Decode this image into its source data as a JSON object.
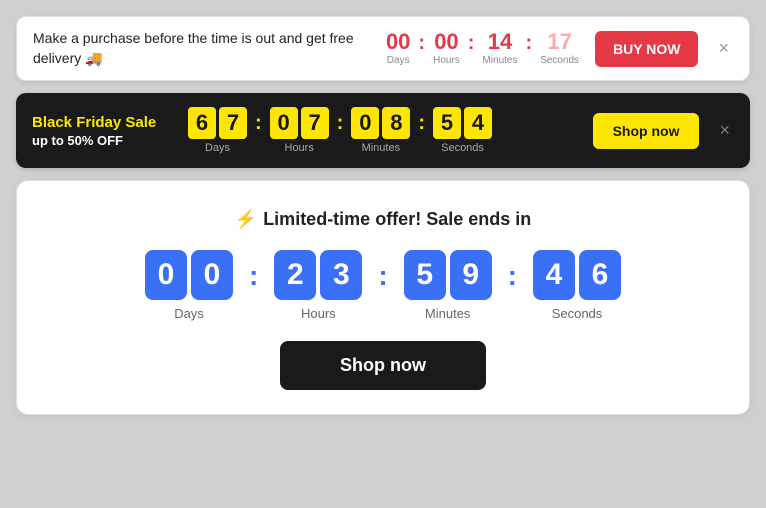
{
  "delivery_banner": {
    "text": "Make a purchase before the time is out and get free delivery 🚚",
    "countdown": {
      "days": {
        "value": "00",
        "label": "Days"
      },
      "hours": {
        "value": "00",
        "label": "Hours"
      },
      "minutes": {
        "value": "14",
        "label": "Minutes"
      },
      "seconds": {
        "value": "17",
        "label": "Seconds"
      }
    },
    "buy_btn": "BUY NOW",
    "close": "×"
  },
  "blackfriday_banner": {
    "title": "Black Friday Sale",
    "subtitle": "up to 50% OFF",
    "countdown": {
      "days": {
        "d1": "6",
        "d2": "7",
        "label": "Days"
      },
      "hours": {
        "d1": "0",
        "d2": "7",
        "label": "Hours"
      },
      "minutes": {
        "d1": "0",
        "d2": "8",
        "label": "Minutes"
      },
      "seconds": {
        "d1": "5",
        "d2": "4",
        "label": "Seconds"
      }
    },
    "shop_btn": "Shop now",
    "close": "×"
  },
  "sale_banner": {
    "icon": "⚡",
    "title": "Limited-time offer! Sale ends in",
    "countdown": {
      "days": {
        "d1": "0",
        "d2": "0",
        "label": "Days"
      },
      "hours": {
        "d1": "2",
        "d2": "3",
        "label": "Hours"
      },
      "minutes": {
        "d1": "5",
        "d2": "9",
        "label": "Minutes"
      },
      "seconds": {
        "d1": "4",
        "d2": "6",
        "label": "Seconds"
      }
    },
    "shop_btn": "Shop now"
  }
}
